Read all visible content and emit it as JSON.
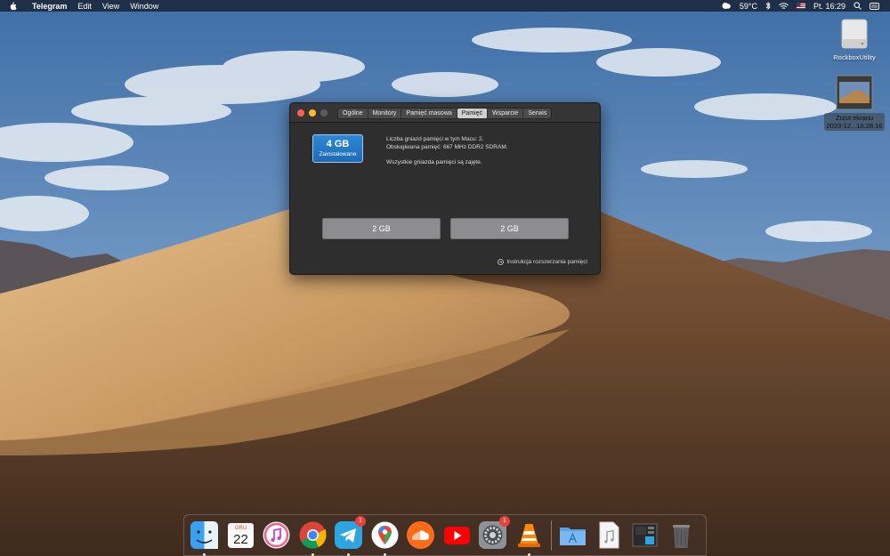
{
  "menubar": {
    "app_name": "Telegram",
    "items": [
      "Edit",
      "View",
      "Window"
    ],
    "weather": "59°C",
    "clock": "Pt. 16:29"
  },
  "desktop": {
    "drive_label": "RockboxUtility",
    "screenshot_label_line1": "Zrzut ekranu",
    "screenshot_label_line2": "2023-12...16.28.16"
  },
  "window": {
    "tabs": [
      "Ogólne",
      "Monitory",
      "Pamięć masowa",
      "Pamięć",
      "Wsparcie",
      "Serwis"
    ],
    "active_tab": "Pamięć",
    "memory_size": "4 GB",
    "memory_status": "Zainstalowane",
    "info_line1": "Liczba gniazd pamięci w tym Macu: 2.",
    "info_line2": "Obsługiwana pamięć: 667 MHz DDR2 SDRAM.",
    "info_line3": "Wszystkie gniazda pamięci są zajęte.",
    "slots": [
      "2 GB",
      "2 GB"
    ],
    "help_link": "Instrukcja rozszerzania pamięci"
  },
  "dock": {
    "calendar_month": "GRU",
    "calendar_day": "22",
    "telegram_badge": "1",
    "prefs_badge": "1",
    "icons": [
      "finder-icon",
      "calendar-icon",
      "music-icon",
      "chrome-icon",
      "telegram-icon",
      "maps-icon",
      "soundcloud-icon",
      "youtube-icon",
      "system-preferences-icon",
      "vlc-icon",
      "applications-folder-icon",
      "document-icon",
      "screenshot-thumbnail-icon",
      "trash-icon"
    ]
  },
  "colors": {
    "accent_blue": "#2d89d6",
    "close": "#fe5f57",
    "minimize": "#febc2e",
    "zoom_disabled": "#5b5b5c"
  }
}
